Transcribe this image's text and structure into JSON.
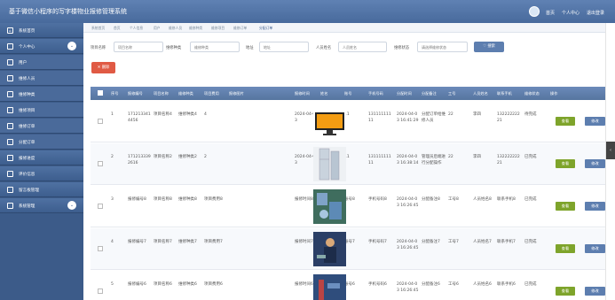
{
  "header": {
    "title": "基于微信小程序的写字楼物业报修管理系统",
    "links": [
      "首页",
      "个人中心",
      "退出登录"
    ]
  },
  "sidebar": {
    "items": [
      {
        "label": "系统首页",
        "icon": "home-icon"
      },
      {
        "label": "个人中心",
        "icon": "user-icon"
      },
      {
        "label": "用户",
        "icon": "user-icon"
      },
      {
        "label": "维修人员",
        "icon": "user-icon"
      },
      {
        "label": "维修种类",
        "icon": "tag-icon"
      },
      {
        "label": "维修项目",
        "icon": "list-icon"
      },
      {
        "label": "维修订单",
        "icon": "order-icon"
      },
      {
        "label": "分配订单",
        "icon": "chart-icon"
      },
      {
        "label": "报修进度",
        "icon": "progress-icon"
      },
      {
        "label": "评价信息",
        "icon": "comment-icon"
      },
      {
        "label": "留言板管理",
        "icon": "message-icon"
      },
      {
        "label": "系统管理",
        "icon": "settings-icon"
      }
    ]
  },
  "breadcrumb": [
    "系统首页",
    "首页",
    "个人信息",
    "用户",
    "维修人员",
    "维修种类",
    "维修项目",
    "维修订单",
    "分配订单"
  ],
  "filters": {
    "project_name": {
      "label": "项目名称",
      "placeholder": "项目名称"
    },
    "repair_type": {
      "label": "维修种类",
      "placeholder": "维修种类"
    },
    "address": {
      "label": "地址",
      "placeholder": "地址"
    },
    "staff_name": {
      "label": "人员姓名",
      "placeholder": "人员姓名"
    },
    "repair_status": {
      "label": "维修状态",
      "placeholder": "请选择维修状态"
    },
    "search_label": "搜索"
  },
  "delete_label": "删除",
  "table": {
    "columns": [
      "序号",
      "报修编号",
      "项目名称",
      "维修种类",
      "项目费用",
      "报修图片",
      "报修时间",
      "姓名",
      "账号",
      "手机号码",
      "分配时间",
      "分配备注",
      "工号",
      "人员姓名",
      "联系手机",
      "维修状态",
      "操作"
    ],
    "rows": [
      {
        "idx": "1",
        "no": "1712133414456",
        "project": "项目名称4",
        "type": "维修种类4",
        "fee": "4",
        "img": "monitor",
        "time": "2024-04-03",
        "name": "张三",
        "account": "11",
        "phone": "13111111111",
        "assign_time": "2024-04-03 16:41:29",
        "remark": "分配订单给维修人员",
        "job_no": "22",
        "staff": "李四",
        "staff_phone": "13222222221",
        "status": "待完成"
      },
      {
        "idx": "2",
        "no": "1712133392616",
        "project": "项目名称2",
        "type": "维修种类2",
        "fee": "2",
        "img": "fridge",
        "time": "2024-04-03",
        "name": "张三",
        "account": "11",
        "phone": "13111111111",
        "assign_time": "2024-04-03 16:38:14",
        "remark": "管理员后端进行分配操作",
        "job_no": "22",
        "staff": "李四",
        "staff_phone": "13222222221",
        "status": "已完成"
      },
      {
        "idx": "3",
        "no": "报修编号8",
        "project": "项目名称8",
        "type": "维修种类8",
        "fee": "项目费用8",
        "img": "plumbing",
        "time": "报修时间8",
        "name": "姓名8",
        "account": "账号8",
        "phone": "手机号码8",
        "assign_time": "2024-04-03 16:26:45",
        "remark": "分配备注8",
        "job_no": "工号8",
        "staff": "人员姓名8",
        "staff_phone": "联系手机8",
        "status": "已完成"
      },
      {
        "idx": "4",
        "no": "报修编号7",
        "project": "项目名称7",
        "type": "维修种类7",
        "fee": "项目费用7",
        "img": "worker",
        "time": "报修时间7",
        "name": "姓名7",
        "account": "账号7",
        "phone": "手机号码7",
        "assign_time": "2024-04-03 16:26:45",
        "remark": "分配备注7",
        "job_no": "工号7",
        "staff": "人员姓名7",
        "staff_phone": "联系手机7",
        "status": "已完成"
      },
      {
        "idx": "5",
        "no": "报修编号6",
        "project": "项目名称6",
        "type": "维修种类6",
        "fee": "项目费用6",
        "img": "pipe",
        "time": "报修时间6",
        "name": "姓名6",
        "account": "账号6",
        "phone": "手机号码6",
        "assign_time": "2024-04-03 16:26:45",
        "remark": "分配备注6",
        "job_no": "工号6",
        "staff": "人员姓名6",
        "staff_phone": "联系手机6",
        "status": "已完成"
      }
    ],
    "actions": {
      "view": "查看",
      "edit": "修改"
    }
  },
  "colors": {
    "header": "#5677a8",
    "sidebar": "#3d5e8e",
    "accent": "#5d7eaf",
    "view": "#7ea42b",
    "delete": "#e05a44"
  }
}
